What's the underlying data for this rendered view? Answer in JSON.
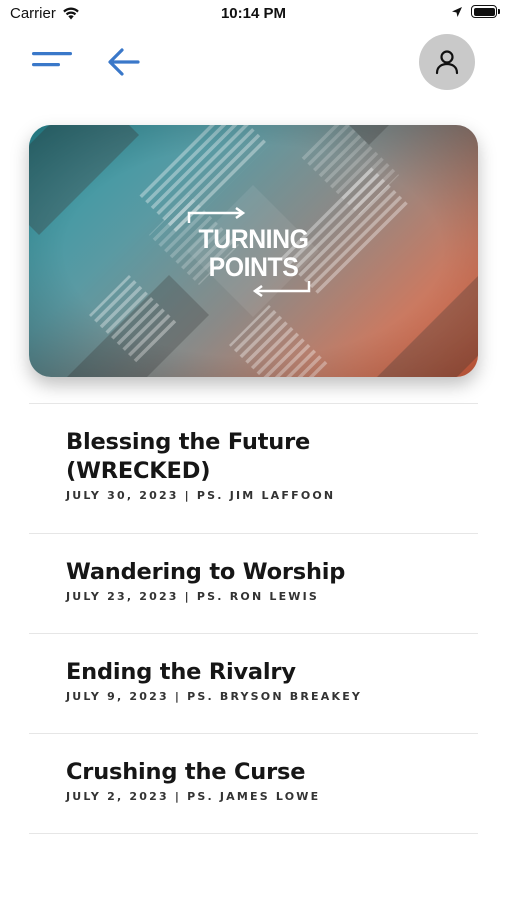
{
  "status_bar": {
    "carrier": "Carrier",
    "time": "10:14 PM",
    "battery_level": 1.0
  },
  "header": {
    "menu_icon": "hamburger-menu-icon",
    "back_icon": "arrow-left-icon",
    "profile_icon": "user-profile-icon",
    "accent_color": "#3a78c9"
  },
  "hero": {
    "title_line1": "TURNING",
    "title_line2": "POINTS",
    "gradient_colors": [
      "#2b9aa6",
      "#ee6a45"
    ]
  },
  "sermons": [
    {
      "title": "Blessing the Future (WRECKED)",
      "title_line1": "Blessing the Future",
      "title_line2": "(WRECKED)",
      "subtitle": "JULY 30, 2023 | PS. JIM LAFFOON"
    },
    {
      "title": "Wandering to Worship",
      "subtitle": "JULY 23, 2023 | PS. RON LEWIS"
    },
    {
      "title": "Ending the Rivalry",
      "subtitle": "JULY 9, 2023 | PS. BRYSON BREAKEY"
    },
    {
      "title": "Crushing the Curse",
      "subtitle": "JULY 2, 2023 | PS. JAMES LOWE"
    }
  ]
}
